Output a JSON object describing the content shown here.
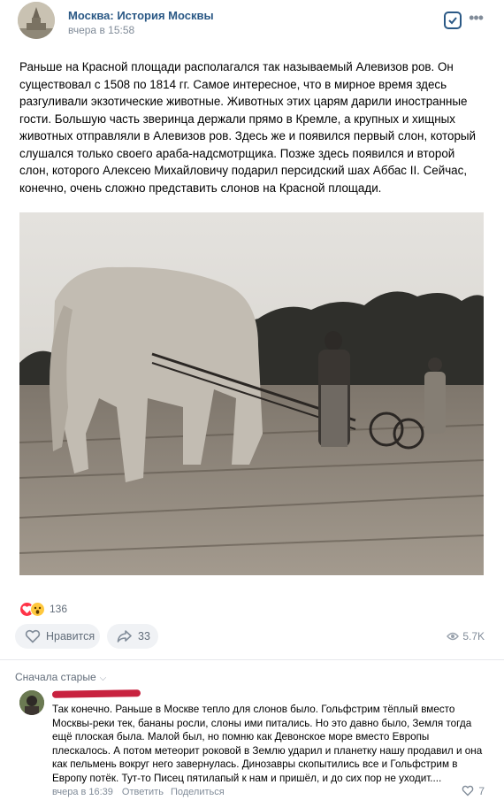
{
  "post": {
    "group_name": "Москва: История Москвы",
    "time": "вчера в 15:58",
    "text": "Раньше на Красной площади располагался так называемый Алевизов ров. Он существовал с 1508 по 1814 гг. Самое интересное, что в мирное время здесь разгуливали экзотические животные. Животных этих царям дарили иностранные гости. Большую часть зверинца держали прямо в Кремле, а крупных и хищных животных отправляли в Алевизов ров. Здесь же и появился первый слон, который слушался только своего араба-надсмотрщика. Позже здесь появился и второй слон, которого Алексею Михайловичу подарил персидский шах Аббас II. Сейчас, конечно, очень сложно представить слонов на Красной площади.",
    "reactions_count": "136",
    "like_label": "Нравится",
    "share_count": "33",
    "views": "5.7K"
  },
  "comments": {
    "sort_label": "Сначала старые",
    "items": [
      {
        "text": "Так конечно. Раньше в Москве тепло для слонов было. Гольфстрим тёплый вместо Москвы-реки тек, бананы росли, слоны ими питались. Но это давно было, Земля тогда ещё плоская была. Малой был, но помню как Девонское море вместо Европы плескалось. А потом метеорит роковой в Землю ударил и планетку нашу продавил и она как пельмень вокруг него завернулась. Динозавры скопытились все и Гольфстрим в Европу потёк. Тут-то Писец пятилапый к нам и пришёл, и до сих пор не уходит....",
        "time": "вчера в 16:39",
        "reply_label": "Ответить",
        "share_label": "Поделиться",
        "likes": "7"
      }
    ]
  },
  "colors": {
    "link": "#2a5885",
    "secondary": "#818c99",
    "button_bg": "#f0f2f5"
  }
}
